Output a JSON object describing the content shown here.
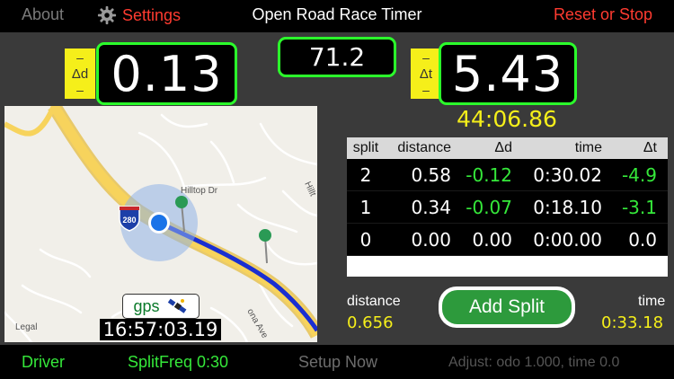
{
  "topbar": {
    "about_label": "About",
    "settings_label": "Settings",
    "title": "Open Road Race Timer",
    "reset_label": "Reset or Stop"
  },
  "readouts": {
    "delta_d": {
      "tag_minus_top": "–",
      "tag_label": "Δd",
      "tag_minus_bottom": "–",
      "value": "0.13"
    },
    "center_value": "71.2",
    "delta_t": {
      "tag_minus_top": "–",
      "tag_label": "Δt",
      "tag_minus_bottom": "–",
      "value": "5.43"
    },
    "elapsed": "44:06.86"
  },
  "map": {
    "road_label": "Hilltop Dr",
    "road_label_2": "Hillt",
    "road_label_3": "ona Ave",
    "interstate_shield": "280",
    "legal": "Legal",
    "gps_label": "gps",
    "clock": "16:57:03.19"
  },
  "splits": {
    "headers": [
      "split",
      "distance",
      "Δd",
      "time",
      "Δt"
    ],
    "rows": [
      {
        "split": "2",
        "distance": "0.58",
        "dd": "-0.12",
        "time": "0:30.02",
        "dt": "-4.9"
      },
      {
        "split": "1",
        "distance": "0.34",
        "dd": "-0.07",
        "time": "0:18.10",
        "dt": "-3.1"
      },
      {
        "split": "0",
        "distance": "0.00",
        "dd": "0.00",
        "time": "0:00.00",
        "dt": "0.0"
      }
    ]
  },
  "stats": {
    "distance_label": "distance",
    "distance_value": "0.656",
    "time_label": "time",
    "time_value": "0:33.18",
    "add_split_label": "Add Split"
  },
  "bottombar": {
    "driver_label": "Driver",
    "splitfreq_label": "SplitFreq 0:30",
    "setup_label": "Setup Now",
    "adjust_label": "Adjust: odo 1.000, time 0.0"
  },
  "colors": {
    "accent_green": "#2bff2b",
    "highlight_yellow": "#f5ef1a",
    "alert_red": "#ff3b30",
    "button_green": "#2d9a3c",
    "route_blue": "#1a2fd1"
  },
  "icons": [
    "gear-icon",
    "interstate-shield-icon",
    "location-dot-icon",
    "map-pin-icon",
    "satellite-icon"
  ]
}
